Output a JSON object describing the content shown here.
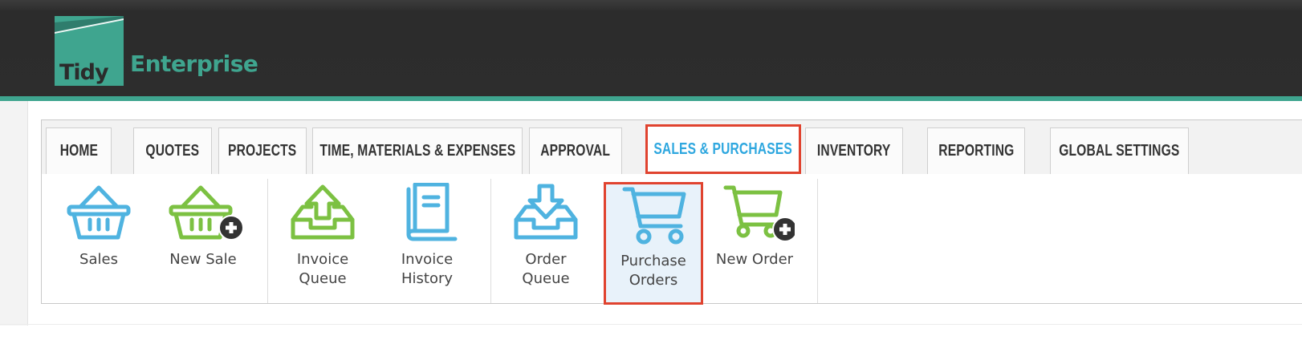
{
  "brand": {
    "logo_word_1": "Tidy",
    "logo_word_2": "Enterprise",
    "accent_color": "#3fa58f"
  },
  "tabs": [
    {
      "label": "HOME",
      "active": false
    },
    {
      "label": "QUOTES",
      "active": false
    },
    {
      "label": "PROJECTS",
      "active": false
    },
    {
      "label": "TIME, MATERIALS & EXPENSES",
      "active": false
    },
    {
      "label": "APPROVAL",
      "active": false
    },
    {
      "label": "SALES & PURCHASES",
      "active": true
    },
    {
      "label": "INVENTORY",
      "active": false
    },
    {
      "label": "REPORTING",
      "active": false
    },
    {
      "label": "GLOBAL SETTINGS",
      "active": false
    }
  ],
  "toolbar": [
    {
      "label": "Sales",
      "icon": "basket-icon"
    },
    {
      "label": "New Sale",
      "icon": "basket-add-icon"
    },
    {
      "label": "Invoice\nQueue",
      "icon": "tray-upload-icon"
    },
    {
      "label": "Invoice\nHistory",
      "icon": "book-icon"
    },
    {
      "label": "Order\nQueue",
      "icon": "tray-download-icon"
    },
    {
      "label": "Purchase\nOrders",
      "icon": "cart-icon",
      "active": true
    },
    {
      "label": "New Order",
      "icon": "cart-add-icon"
    }
  ],
  "colors": {
    "header_bg": "#2d2d2d",
    "active_tab_text": "#2ea7df",
    "highlight_border": "#e0432f",
    "icon_blue": "#4fb3e0",
    "icon_green": "#7cc142"
  }
}
